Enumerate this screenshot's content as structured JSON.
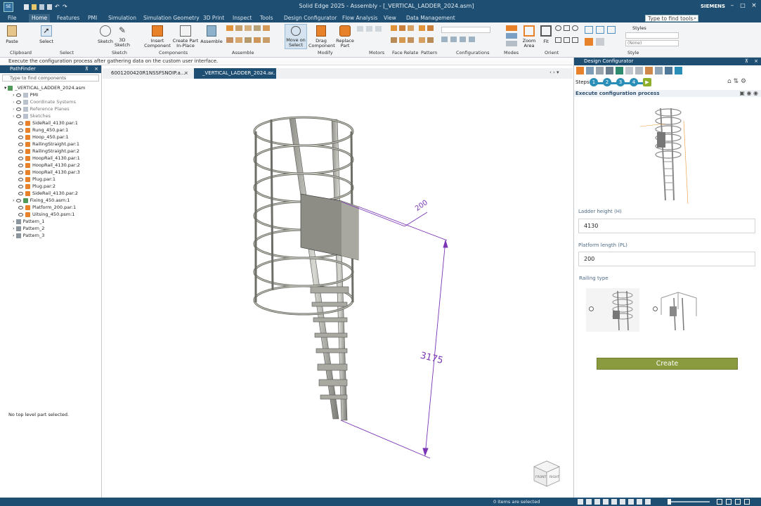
{
  "title": "Solid Edge 2025 - Assembly - [_VERTICAL_LADDER_2024.asm]",
  "brand": "SIEMENS",
  "menu": [
    "File",
    "Home",
    "Features",
    "PMI",
    "Simulation",
    "Simulation Geometry",
    "3D Print",
    "Inspect",
    "Tools",
    "Design Configurator",
    "Flow Analysis",
    "View",
    "Data Management"
  ],
  "search_placeholder": "Type to find tools",
  "ribbon": {
    "buttons": {
      "paste": "Paste",
      "select": "Select",
      "sketch": "Sketch",
      "sketch3d": "3D Sketch",
      "insert": "Insert Component",
      "create_part": "Create Part In-Place",
      "assemble": "Assemble",
      "move": "Move on Select",
      "drag": "Drag Component",
      "replace": "Replace Part",
      "zoom_area": "Zoom Area",
      "fit": "Fit",
      "styles": "Styles",
      "style_value": "(None)"
    },
    "groups": [
      "Clipboard",
      "Select",
      "Sketch",
      "Components",
      "Assemble",
      "Modify",
      "Motors",
      "Face Relate",
      "Pattern",
      "Configurations",
      "Modes",
      "Orient",
      "Style"
    ]
  },
  "infobar": "Execute the configuration process after gathering data on the custom user interface.",
  "pathfinder": {
    "title": "PathFinder",
    "search": "Type to find components",
    "root": "_VERTICAL_LADDER_2024.asm",
    "items": [
      "PMI",
      "Coordinate Systems",
      "Reference Planes",
      "Sketches",
      "SideRail_4130.par:1",
      "Rung_450.par:1",
      "Hoop_450.par:1",
      "RailingStraight.par:1",
      "RailingStraight.par:2",
      "HoopRail_4130.par:1",
      "HoopRail_4130.par:2",
      "HoopRail_4130.par:3",
      "Plug.par:1",
      "Plug.par:2",
      "SideRail_4130.par:2",
      "Fixing_450.asm:1",
      "Platform_200.par:1",
      "Uitsing_450.psm:1",
      "Pattern_1",
      "Pattern_2",
      "Pattern_3"
    ],
    "footer": "No top level part selected."
  },
  "tabs": [
    "6001200420R1NSSFSNOIP.a...",
    "_VERTICAL_LADDER_2024.a..."
  ],
  "dimensions": {
    "small": "200",
    "large": "3175"
  },
  "viewcube": {
    "front": "FRONT",
    "right": "RIGHT"
  },
  "configurator": {
    "title": "Design Configurator",
    "steps_label": "Steps",
    "steps": [
      "1",
      "2",
      "3",
      "4"
    ],
    "heading": "Execute configuration process",
    "fields": [
      {
        "label": "Ladder height (H)",
        "value": "4130"
      },
      {
        "label": "Platform length (PL)",
        "value": "200"
      }
    ],
    "railing_label": "Railing type",
    "create": "Create"
  },
  "status": "0 items are selected",
  "colors": {
    "titlebar": "#1e4f73",
    "accent_button": "#8a9a3f",
    "dimension": "#7b35b5",
    "step": "#2a8fb8",
    "step_active": "#8fae2a"
  }
}
